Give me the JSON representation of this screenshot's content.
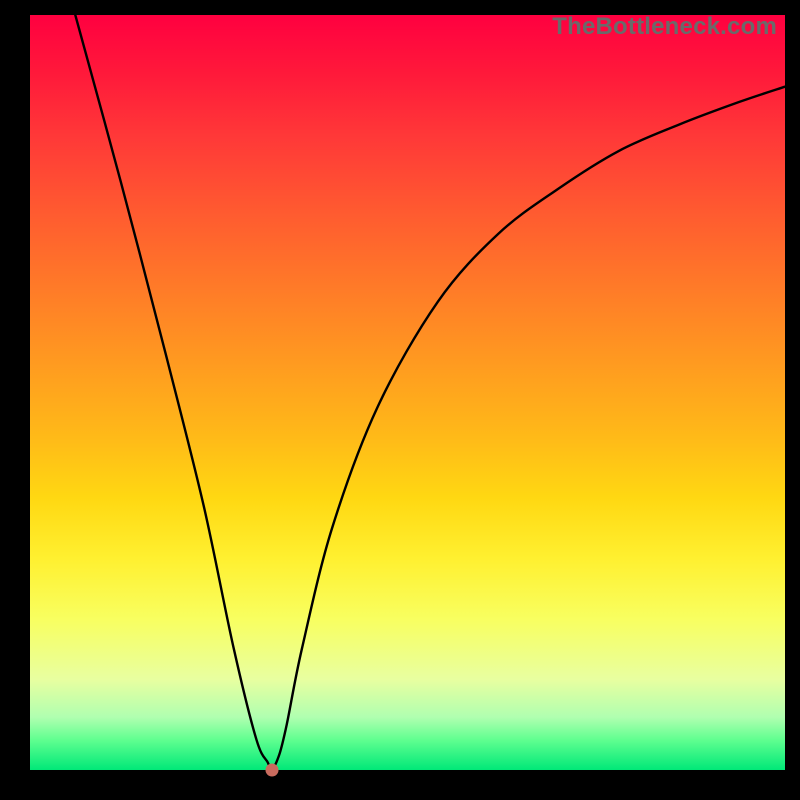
{
  "watermark": "TheBottleneck.com",
  "chart_data": {
    "type": "line",
    "title": "",
    "xlabel": "",
    "ylabel": "",
    "xlim": [
      0,
      100
    ],
    "ylim": [
      0,
      100
    ],
    "grid": false,
    "series": [
      {
        "name": "curve",
        "x": [
          6,
          12,
          18,
          23,
          27,
          30,
          31.5,
          32,
          33,
          34,
          36,
          40,
          46,
          54,
          62,
          70,
          78,
          86,
          94,
          100
        ],
        "y": [
          100,
          78,
          55,
          35,
          16,
          4,
          1,
          0,
          2,
          6,
          16,
          32,
          48,
          62,
          71,
          77,
          82,
          85.5,
          88.5,
          90.5
        ]
      }
    ],
    "marker": {
      "x": 32,
      "y": 0,
      "color": "#c96b5e"
    },
    "gradient_stops": [
      {
        "pos": 0.0,
        "color": "#ff0040"
      },
      {
        "pos": 0.25,
        "color": "#ff5a30"
      },
      {
        "pos": 0.55,
        "color": "#ffd020"
      },
      {
        "pos": 0.8,
        "color": "#f8ff60"
      },
      {
        "pos": 1.0,
        "color": "#00e878"
      }
    ]
  }
}
